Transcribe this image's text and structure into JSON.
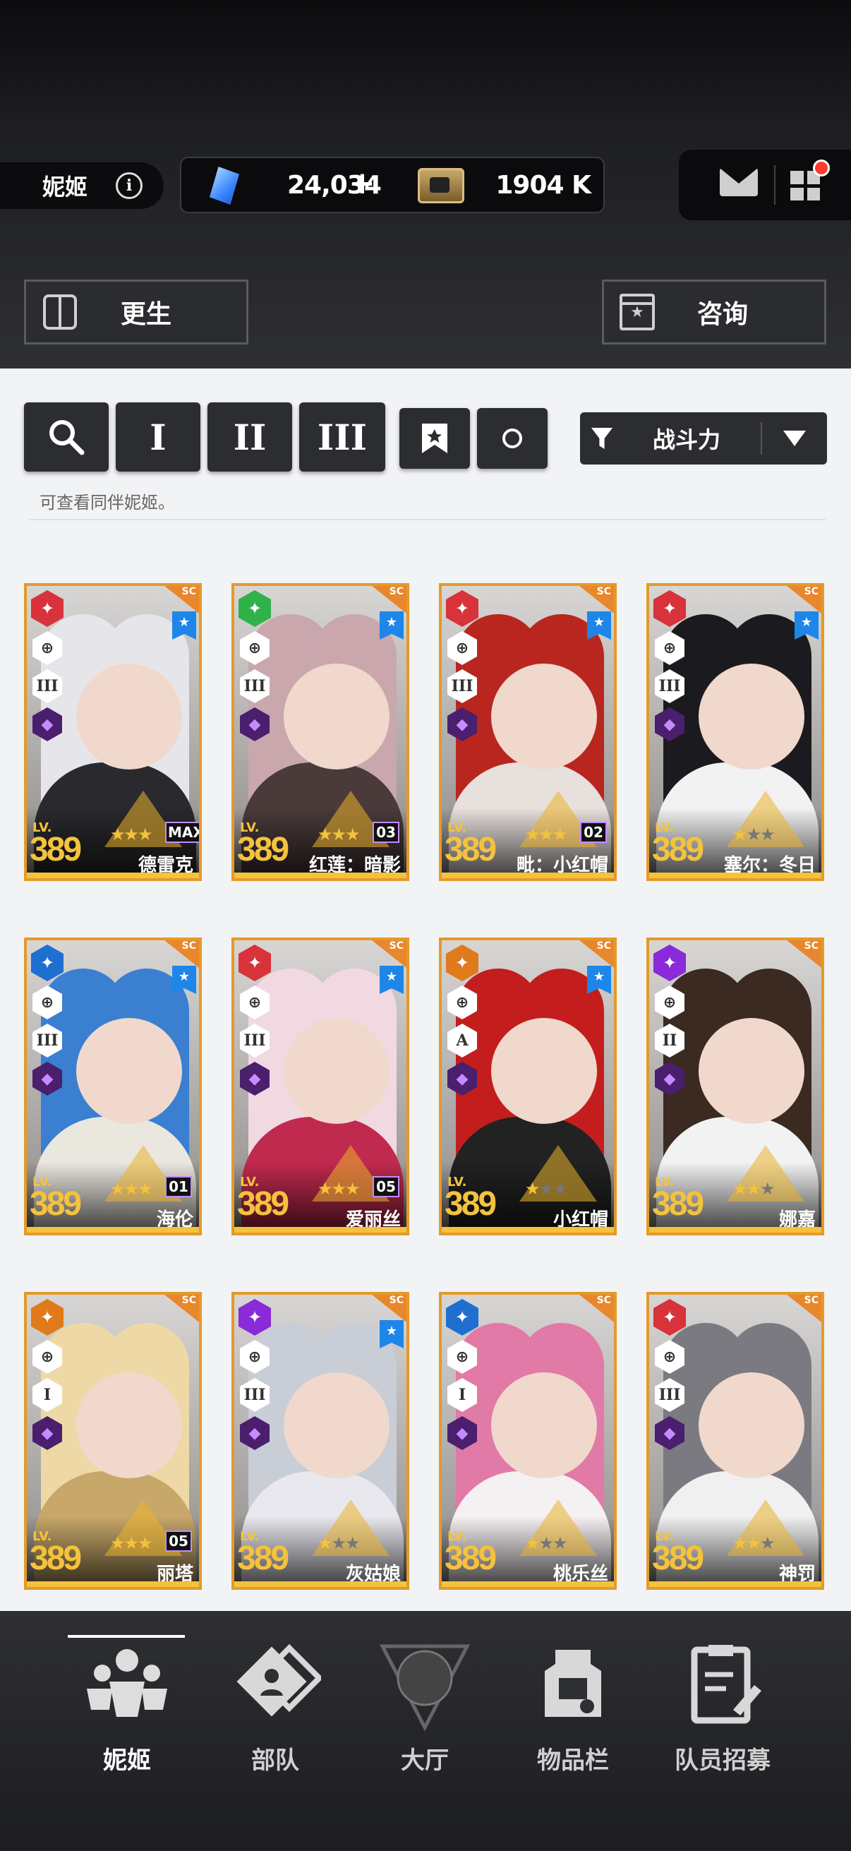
{
  "header": {
    "name": "妮姬",
    "gems": "24,034",
    "gems_plus": "+",
    "credits": "1904 K"
  },
  "actions": {
    "rebirth": "更生",
    "consult": "咨询"
  },
  "filters": {
    "buttons": [
      "I",
      "II",
      "III"
    ],
    "sort_label": "战斗力",
    "hint": "可查看同伴妮姬。"
  },
  "cards": [
    {
      "name": "德雷克",
      "level": "389",
      "stars": 3,
      "badge": "MAX",
      "element_color": "#d8323a",
      "element": "fire",
      "bookmark": true,
      "burst": "III",
      "hair": "#e6e6ea",
      "outfit": "#2a2a2e"
    },
    {
      "name": "红莲：暗影",
      "level": "389",
      "stars": 3,
      "badge": "03",
      "element_color": "#2fb24a",
      "element": "wind",
      "bookmark": true,
      "burst": "III",
      "hair": "#c9a7ad",
      "outfit": "#4a3a3a"
    },
    {
      "name": "毗：小红帽",
      "level": "389",
      "stars": 3,
      "badge": "02",
      "element_color": "#d8323a",
      "element": "fire",
      "bookmark": true,
      "burst": "III",
      "hair": "#b8261f",
      "outfit": "#e8e0dc"
    },
    {
      "name": "塞尔：冬日",
      "level": "389",
      "stars": 1,
      "badge": "",
      "element_color": "#d8323a",
      "element": "fire",
      "bookmark": true,
      "burst": "III",
      "hair": "#1b1b1f",
      "outfit": "#f2f2f2"
    },
    {
      "name": "海伦",
      "level": "389",
      "stars": 3,
      "badge": "01",
      "element_color": "#1e6fd0",
      "element": "water",
      "bookmark": true,
      "burst": "III",
      "hair": "#3a7fd0",
      "outfit": "#eae7df"
    },
    {
      "name": "爱丽丝",
      "level": "389",
      "stars": 3,
      "badge": "05",
      "element_color": "#d8323a",
      "element": "fire",
      "bookmark": true,
      "burst": "III",
      "hair": "#f1d9e2",
      "outfit": "#c02a4e"
    },
    {
      "name": "小红帽",
      "level": "389",
      "stars": 1,
      "badge": "",
      "element_color": "#e07a1a",
      "element": "iron",
      "bookmark": true,
      "burst": "A",
      "hair": "#c41d1d",
      "outfit": "#222"
    },
    {
      "name": "娜嘉",
      "level": "389",
      "stars": 2,
      "badge": "",
      "element_color": "#8a2ad8",
      "element": "electric",
      "bookmark": false,
      "burst": "II",
      "hair": "#3a2a22",
      "outfit": "#f2f2f2"
    },
    {
      "name": "丽塔",
      "level": "389",
      "stars": 3,
      "badge": "05",
      "element_color": "#e07a1a",
      "element": "iron",
      "bookmark": false,
      "burst": "I",
      "hair": "#eed9a6",
      "outfit": "#c7a76a"
    },
    {
      "name": "灰姑娘",
      "level": "389",
      "stars": 1,
      "badge": "",
      "element_color": "#8a2ad8",
      "element": "electric",
      "bookmark": true,
      "burst": "III",
      "hair": "#c8cdd6",
      "outfit": "#e8e8ee"
    },
    {
      "name": "桃乐丝",
      "level": "389",
      "stars": 1,
      "badge": "",
      "element_color": "#1e6fd0",
      "element": "water",
      "bookmark": false,
      "burst": "I",
      "hair": "#e17aa6",
      "outfit": "#f5f0f2"
    },
    {
      "name": "神罚",
      "level": "389",
      "stars": 2,
      "badge": "",
      "element_color": "#d8323a",
      "element": "fire",
      "bookmark": false,
      "burst": "III",
      "hair": "#7a7a80",
      "outfit": "#f0f0f0"
    }
  ],
  "nav": [
    {
      "label": "妮姬",
      "icon": "nikke-icon",
      "active": true
    },
    {
      "label": "部队",
      "icon": "squad-icon",
      "active": false
    },
    {
      "label": "大厅",
      "icon": "lobby-icon",
      "active": false
    },
    {
      "label": "物品栏",
      "icon": "inventory-icon",
      "active": false
    },
    {
      "label": "队员招募",
      "icon": "recruit-icon",
      "active": false
    }
  ],
  "common": {
    "lv_label": "LV.",
    "sc": "SC"
  }
}
